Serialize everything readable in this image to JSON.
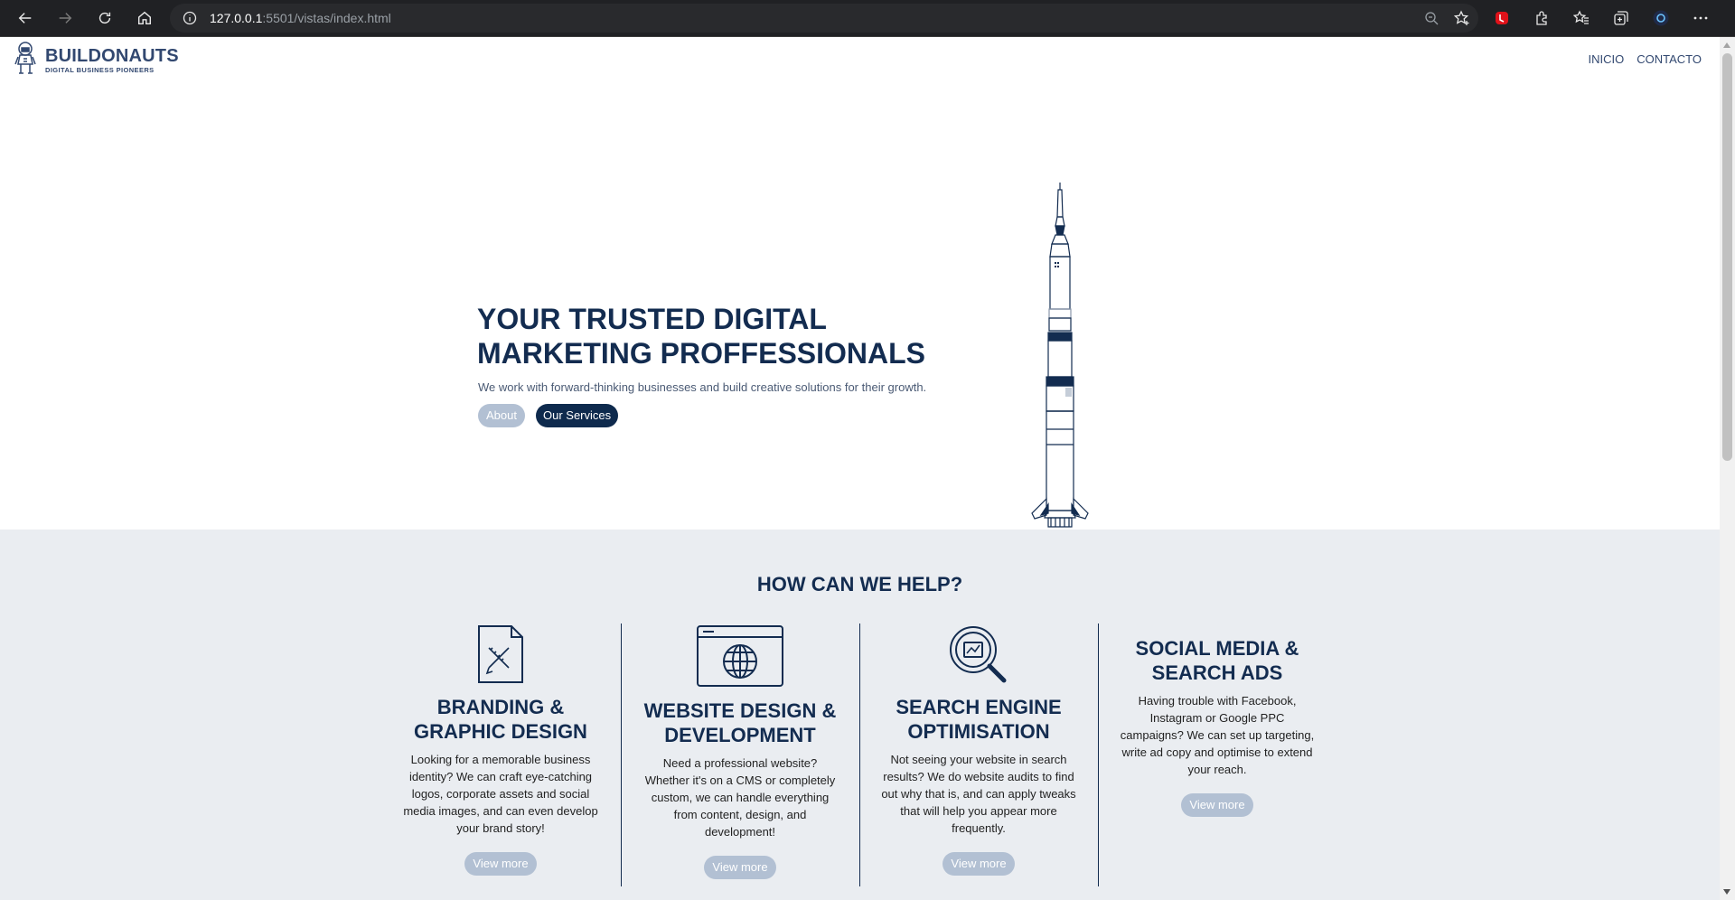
{
  "browser": {
    "url_host": "127.0.0.1",
    "url_path": ":5501/vistas/index.html"
  },
  "navbar": {
    "brand_name": "BUILDONAUTS",
    "brand_tagline": "DIGITAL BUSINESS PIONEERS",
    "links": [
      "INICIO",
      "CONTACTO"
    ]
  },
  "hero": {
    "title_line1": "YOUR TRUSTED DIGITAL",
    "title_line2": "MARKETING PROFFESSIONALS",
    "subtitle": "We work with forward-thinking businesses and build creative solutions for their growth.",
    "btn_about": "About",
    "btn_services": "Our Services"
  },
  "services": {
    "heading": "HOW CAN WE HELP?",
    "items": [
      {
        "title_line1": "BRANDING &",
        "title_line2": "GRAPHIC DESIGN",
        "desc": "Looking for a memorable business identity? We can craft eye-catching logos, corporate assets and social media images, and can even develop your brand story!",
        "button": "View more",
        "icon": "document-design-icon"
      },
      {
        "title_line1": "WEBSITE DESIGN &",
        "title_line2": "DEVELOPMENT",
        "desc": "Need a professional website? Whether it's on a CMS or completely custom, we can handle everything from content, design, and development!",
        "button": "View more",
        "icon": "browser-globe-icon"
      },
      {
        "title_line1": "SEARCH ENGINE",
        "title_line2": "OPTIMISATION",
        "desc": "Not seeing your website in search results? We do website audits to find out why that is, and can apply tweaks that will help you appear more frequently.",
        "button": "View more",
        "icon": "magnifier-chart-icon"
      },
      {
        "title_line1": "SOCIAL MEDIA &",
        "title_line2": "SEARCH ADS",
        "desc": "Having trouble with Facebook, Instagram or Google PPC campaigns? We can set up targeting, write ad copy and optimise to extend your reach.",
        "button": "View more",
        "icon": ""
      }
    ]
  },
  "colors": {
    "primary": "#132c50",
    "muted_button": "#b2c0d3",
    "section_bg": "#eaedf1"
  }
}
